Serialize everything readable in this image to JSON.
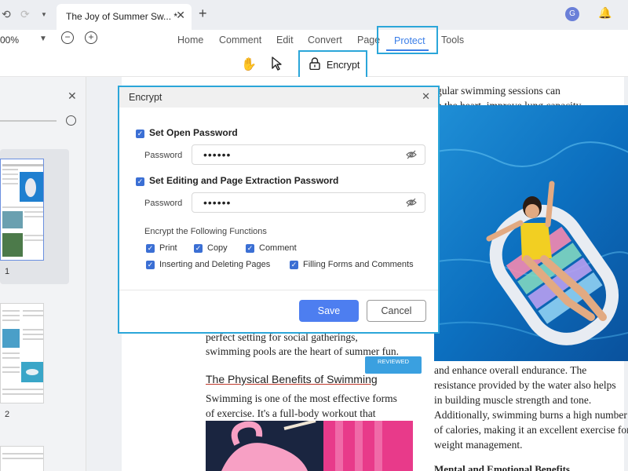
{
  "titlebar": {
    "tab_title": "The Joy of Summer Sw... *",
    "tab_close": "✕",
    "add_tab": "+",
    "avatar_initial": "G",
    "nav_icons": [
      "undo-icon",
      "redo-icon",
      "dropdown-icon"
    ]
  },
  "toolbar": {
    "zoom_value": "00%",
    "menu": [
      "Home",
      "Comment",
      "Edit",
      "Convert",
      "Page",
      "Protect",
      "Tools"
    ],
    "active_menu": "Protect",
    "encrypt_label": "Encrypt",
    "tools": [
      "hand-icon",
      "pointer-icon"
    ]
  },
  "left_panel": {
    "page_numbers": [
      "1",
      "2"
    ]
  },
  "dialog": {
    "title": "Encrypt",
    "open_password": {
      "label": "Set Open Password",
      "checked": true,
      "field_label": "Password",
      "value": "••••••"
    },
    "edit_password": {
      "label": "Set Editing and Page Extraction Password",
      "checked": true,
      "field_label": "Password",
      "value": "••••••"
    },
    "functions_label": "Encrypt the Following Functions",
    "functions": [
      {
        "label": "Print",
        "checked": true
      },
      {
        "label": "Copy",
        "checked": true
      },
      {
        "label": "Comment",
        "checked": true
      },
      {
        "label": "Inserting and Deleting Pages",
        "checked": true
      },
      {
        "label": "Filling Forms and Comments",
        "checked": true
      }
    ],
    "save_label": "Save",
    "cancel_label": "Cancel"
  },
  "document": {
    "right_top_line1": "egular swimming sessions can",
    "right_top_line2": "en the heart, improve lung capacity,",
    "left_line1": "perfect setting for social gatherings,",
    "left_line2": "swimming pools are the heart of summer fun.",
    "heading": "The Physical Benefits of Swimming",
    "left_para_line1": "Swimming is one of the most effective forms",
    "left_para_line2": "of exercise. It's a full-body workout that",
    "right_para": [
      "and enhance overall endurance. The",
      "resistance provided by the water also helps",
      "in building muscle strength and tone.",
      "Additionally, swimming burns a high number",
      "of calories, making it an excellent exercise for",
      "weight management."
    ],
    "right_bottom_partial": "Mental and Emotional Benefits",
    "badge_main": "REVIEWED"
  },
  "colors": {
    "accent": "#3a7ee8",
    "highlight_border": "#2ba6d9",
    "save_button": "#4d7ef0",
    "checkbox": "#3b6fd4"
  }
}
